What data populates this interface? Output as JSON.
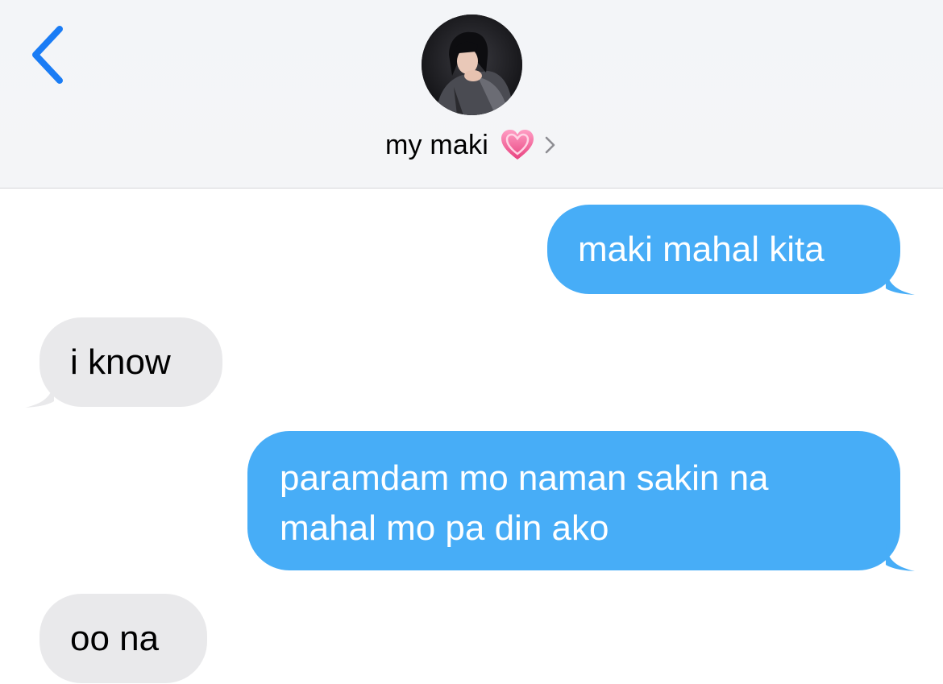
{
  "header": {
    "back_icon": "chevron-left-icon",
    "contact_name": "my maki",
    "contact_emoji": "heart-icon",
    "contact_chevron": "chevron-right-icon",
    "accent_color": "#1a7cf5"
  },
  "messages": [
    {
      "direction": "sent",
      "lines": [
        "maki mahal kita"
      ]
    },
    {
      "direction": "received",
      "lines": [
        "i know"
      ]
    },
    {
      "direction": "sent",
      "lines": [
        "paramdam mo naman sakin na",
        "mahal mo pa din ako"
      ]
    },
    {
      "direction": "received",
      "lines": [
        "oo na"
      ]
    }
  ],
  "colors": {
    "sent_bubble": "#47adf7",
    "received_bubble": "#e9e9eb",
    "heart": "#f2649b"
  }
}
